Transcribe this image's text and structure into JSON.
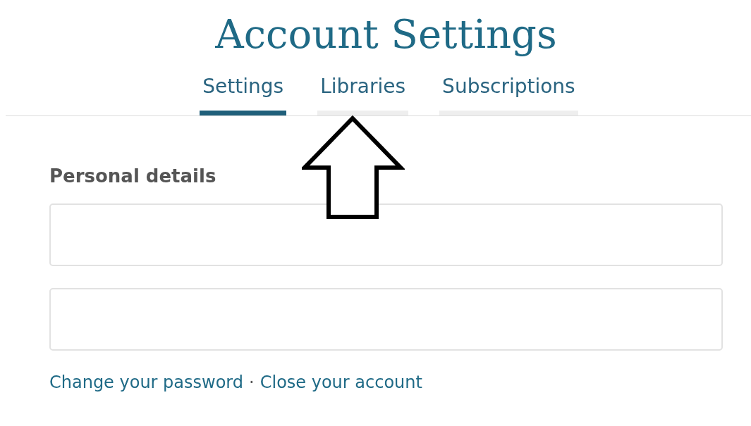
{
  "title": "Account Settings",
  "tabs": [
    {
      "label": "Settings",
      "selected": true
    },
    {
      "label": "Libraries",
      "selected": false
    },
    {
      "label": "Subscriptions",
      "selected": false
    }
  ],
  "annotation": {
    "kind": "arrow"
  },
  "section": {
    "heading": "Personal details",
    "fields": [
      {
        "kind": "text"
      },
      {
        "kind": "text"
      }
    ]
  },
  "links": {
    "items": [
      "Change your password",
      "Close your account"
    ],
    "separator": "·"
  }
}
